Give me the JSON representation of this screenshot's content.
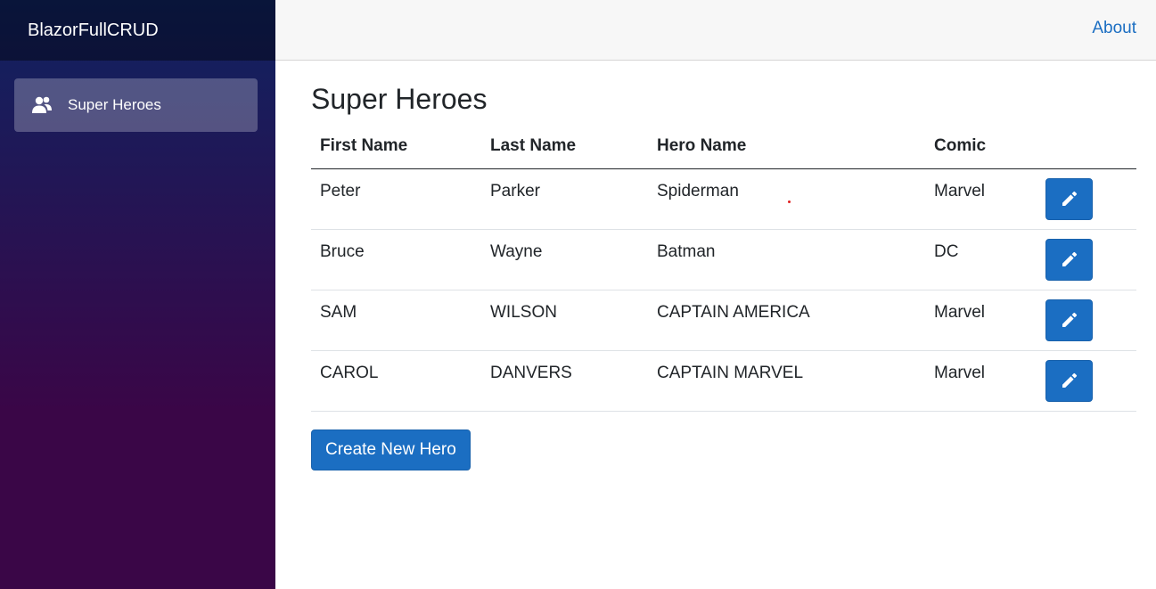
{
  "sidebar": {
    "brand": "BlazorFullCRUD",
    "nav_items": [
      {
        "label": "Super Heroes",
        "icon": "people-icon",
        "active": true
      }
    ]
  },
  "top_row": {
    "about_label": "About"
  },
  "main": {
    "title": "Super Heroes",
    "table": {
      "headers": [
        "First Name",
        "Last Name",
        "Hero Name",
        "Comic"
      ],
      "rows": [
        {
          "first": "Peter",
          "last": "Parker",
          "hero": "Spiderman",
          "comic": "Marvel"
        },
        {
          "first": "Bruce",
          "last": "Wayne",
          "hero": "Batman",
          "comic": "DC"
        },
        {
          "first": "SAM",
          "last": "WILSON",
          "hero": "CAPTAIN AMERICA",
          "comic": "Marvel"
        },
        {
          "first": "CAROL",
          "last": "DANVERS",
          "hero": "CAPTAIN MARVEL",
          "comic": "Marvel"
        }
      ],
      "row_action_icon": "pencil-icon"
    },
    "create_button_label": "Create New Hero"
  },
  "colors": {
    "accent": "#1b6ec2",
    "sidebar_top": "#0f2361",
    "sidebar_bottom": "#3a0647"
  }
}
